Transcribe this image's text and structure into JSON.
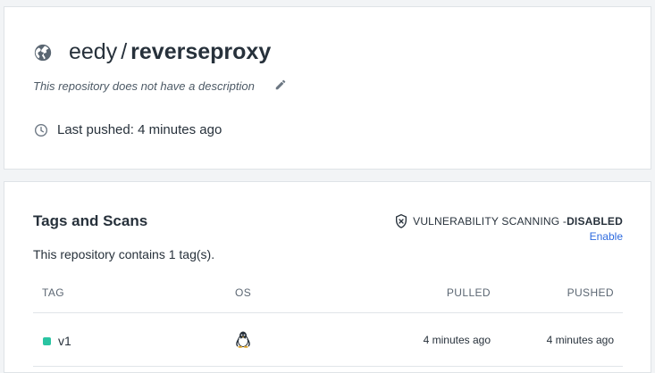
{
  "repo": {
    "namespace": "eedy",
    "separator": "/",
    "name": "reverseproxy",
    "visibility_icon": "globe-icon",
    "description": "This repository does not have a description",
    "last_pushed": "Last pushed: 4 minutes ago"
  },
  "tags_section": {
    "title": "Tags and Scans",
    "vuln_label": "VULNERABILITY SCANNING - ",
    "vuln_status": "DISABLED",
    "enable_link": "Enable",
    "count_text": "This repository contains 1 tag(s).",
    "columns": {
      "tag": "TAG",
      "os": "OS",
      "pulled": "PULLED",
      "pushed": "PUSHED"
    },
    "rows": [
      {
        "tag": "v1",
        "os_icon": "linux-icon",
        "pulled": "4 minutes ago",
        "pushed": "4 minutes ago",
        "status_color": "#2ac4a2"
      }
    ]
  },
  "colors": {
    "link": "#2d6adf",
    "text": "#27313b",
    "muted": "#5c6773",
    "background": "#f2f4f6"
  }
}
